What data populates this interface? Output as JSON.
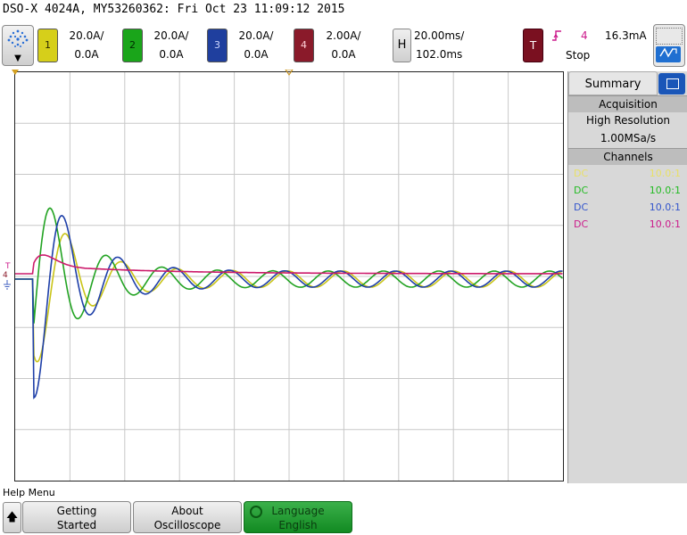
{
  "header": {
    "title": "DSO-X 4024A, MY53260362: Fri Oct 23 11:09:12 2015"
  },
  "channels": [
    {
      "label": "1",
      "scale": "20.0A/",
      "offset": "0.0A",
      "color": "#d6cf1a",
      "text_color": "#2a2600"
    },
    {
      "label": "2",
      "scale": "20.0A/",
      "offset": "0.0A",
      "color": "#1aa51a",
      "text_color": "#002a00"
    },
    {
      "label": "3",
      "scale": "20.0A/",
      "offset": "0.0A",
      "color": "#1f3f9e",
      "text_color": "#cfd8ff"
    },
    {
      "label": "4",
      "scale": "2.00A/",
      "offset": "0.0A",
      "color": "#8a1a2a",
      "text_color": "#ffd0d8"
    }
  ],
  "horizontal": {
    "button": "H",
    "timebase": "20.00ms/",
    "delay": "102.0ms"
  },
  "trigger": {
    "button": "T",
    "edge_icon": "rising-edge-icon",
    "source": "4",
    "level": "16.3mA",
    "state": "Stop"
  },
  "sidepanel": {
    "tab_label": "Summary",
    "acquisition_title": "Acquisition",
    "acquisition_mode": "High Resolution",
    "sample_rate": "1.00MSa/s",
    "channels_title": "Channels",
    "channel_rows": [
      {
        "coupling": "DC",
        "probe": "10.0:1",
        "color": "#e8e066"
      },
      {
        "coupling": "DC",
        "probe": "10.0:1",
        "color": "#22bb22"
      },
      {
        "coupling": "DC",
        "probe": "10.0:1",
        "color": "#3355cc"
      },
      {
        "coupling": "DC",
        "probe": "10.0:1",
        "color": "#cc1a8b"
      }
    ]
  },
  "graticule_markers": {
    "trigger_marker": "T",
    "channel_marker": "4"
  },
  "softkeys": {
    "menu_label": "Help Menu",
    "keys": [
      {
        "line1": "Getting",
        "line2": "Started",
        "active": false
      },
      {
        "line1": "About",
        "line2": "Oscilloscope",
        "active": false
      },
      {
        "line1": "Language",
        "line2": "English",
        "active": true
      }
    ]
  },
  "colors": {
    "ch1": "#c9c418",
    "ch2": "#22a322",
    "ch3": "#1e3fa8",
    "ch4": "#cc1a6b",
    "grid": "#c8c8c8"
  }
}
